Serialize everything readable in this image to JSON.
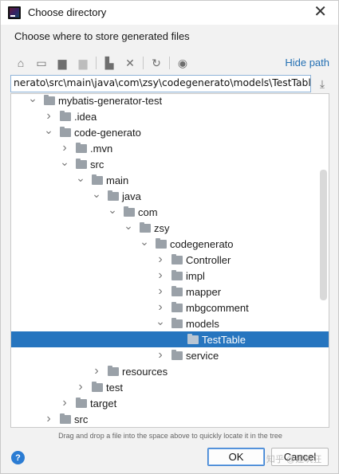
{
  "window": {
    "title": "Choose directory",
    "subtitle": "Choose where to store generated files"
  },
  "toolbar": {
    "buttons": [
      {
        "icon": "home-icon",
        "glyph": "⌂",
        "enabled": true
      },
      {
        "icon": "desktop-icon",
        "glyph": "▭",
        "enabled": true
      },
      {
        "icon": "project-icon",
        "glyph": "▆",
        "enabled": true
      },
      {
        "icon": "module-icon",
        "glyph": "▆",
        "enabled": false
      },
      {
        "icon": "new-folder-icon",
        "glyph": "▙",
        "enabled": true
      },
      {
        "icon": "delete-icon",
        "glyph": "✕",
        "enabled": true
      },
      {
        "icon": "refresh-icon",
        "glyph": "↻",
        "enabled": true
      },
      {
        "icon": "show-hidden-icon",
        "glyph": "◉",
        "enabled": true
      }
    ],
    "hide_path_label": "Hide path"
  },
  "path": {
    "value": "nerato\\src\\main\\java\\com\\zsy\\codegenerato\\models\\TestTable"
  },
  "tree": {
    "items": [
      {
        "label": "mybatis-generator-test",
        "depth": 3,
        "expanded": true
      },
      {
        "label": ".idea",
        "depth": 4,
        "expanded": false
      },
      {
        "label": "code-generato",
        "depth": 4,
        "expanded": true
      },
      {
        "label": ".mvn",
        "depth": 5,
        "expanded": false
      },
      {
        "label": "src",
        "depth": 5,
        "expanded": true
      },
      {
        "label": "main",
        "depth": 6,
        "expanded": true
      },
      {
        "label": "java",
        "depth": 7,
        "expanded": true
      },
      {
        "label": "com",
        "depth": 8,
        "expanded": true
      },
      {
        "label": "zsy",
        "depth": 9,
        "expanded": true
      },
      {
        "label": "codegenerato",
        "depth": 10,
        "expanded": true
      },
      {
        "label": "Controller",
        "depth": 11,
        "expanded": false
      },
      {
        "label": "impl",
        "depth": 11,
        "expanded": false
      },
      {
        "label": "mapper",
        "depth": 11,
        "expanded": false
      },
      {
        "label": "mbgcomment",
        "depth": 11,
        "expanded": false
      },
      {
        "label": "models",
        "depth": 11,
        "expanded": true
      },
      {
        "label": "TestTable",
        "depth": 12,
        "expanded": null,
        "selected": true
      },
      {
        "label": "service",
        "depth": 11,
        "expanded": false
      },
      {
        "label": "resources",
        "depth": 7,
        "expanded": false
      },
      {
        "label": "test",
        "depth": 6,
        "expanded": false
      },
      {
        "label": "target",
        "depth": 5,
        "expanded": false
      },
      {
        "label": "src",
        "depth": 4,
        "expanded": false
      }
    ]
  },
  "hint": "Drag and drop a file into the space above to quickly locate it in the tree",
  "buttons": {
    "help": "?",
    "ok": "OK",
    "cancel": "Cancel"
  },
  "watermark": "知乎 @建筑狂",
  "colors": {
    "selection": "#2675bf",
    "link": "#2470b3",
    "help": "#2b7cd3"
  }
}
